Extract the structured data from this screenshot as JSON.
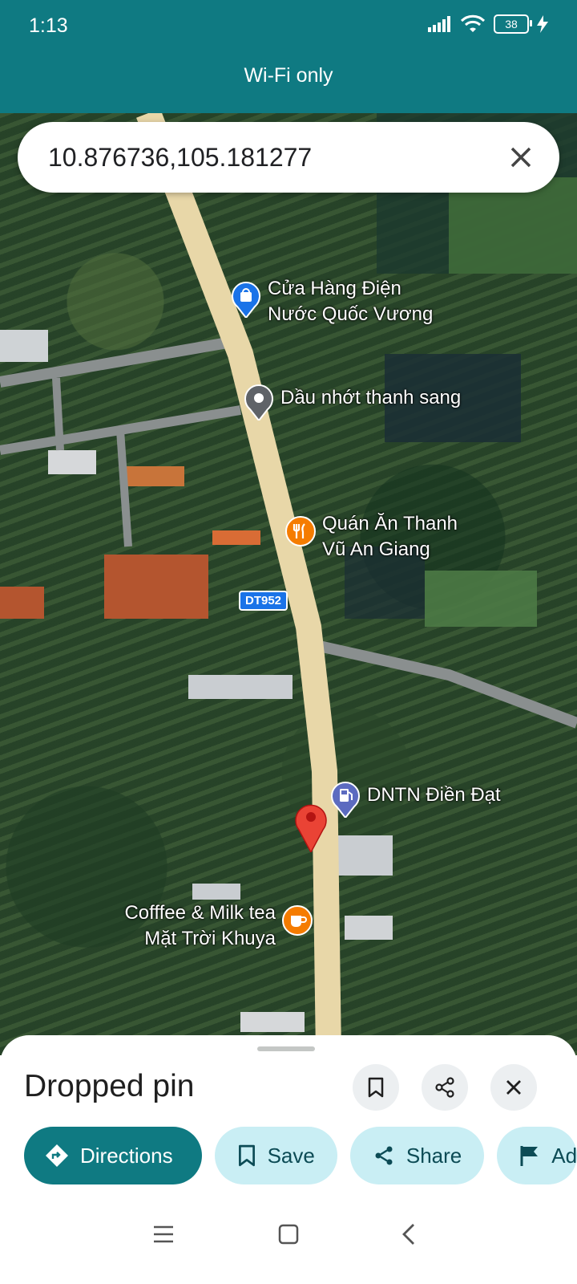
{
  "status_bar": {
    "time": "1:13",
    "battery": "38"
  },
  "banner": {
    "text": "Wi-Fi only"
  },
  "search": {
    "value": "10.876736,105.181277"
  },
  "map": {
    "road_shield": "DT952",
    "places": [
      {
        "name_line1": "Cửa Hàng Điện",
        "name_line2": "Nước Quốc Vương",
        "icon": "shopping-bag-icon",
        "color": "#1a73e8"
      },
      {
        "name_line1": "Dầu nhớt thanh sang",
        "name_line2": "",
        "icon": "place-pin-icon",
        "color": "#5f6368"
      },
      {
        "name_line1": "Quán Ăn Thanh",
        "name_line2": "Vũ An Giang",
        "icon": "restaurant-icon",
        "color": "#f57c00"
      },
      {
        "name_line1": "DNTN Điền Đạt",
        "name_line2": "",
        "icon": "gas-station-icon",
        "color": "#5c6bc0"
      },
      {
        "name_line1": "Cofffee & Milk tea",
        "name_line2": "Mặt Trời Khuya",
        "icon": "cafe-icon",
        "color": "#f57c00"
      }
    ],
    "dropped_pin_color": "#ea4335"
  },
  "sheet": {
    "title": "Dropped pin",
    "actions": [
      {
        "label": "Directions",
        "icon": "directions-icon"
      },
      {
        "label": "Save",
        "icon": "bookmark-icon"
      },
      {
        "label": "Share",
        "icon": "share-icon"
      },
      {
        "label": "Ad",
        "icon": "flag-icon"
      }
    ]
  },
  "colors": {
    "accent": "#0f7a82",
    "chip_bg": "#c9eef4",
    "chip_text": "#0c4b55"
  }
}
